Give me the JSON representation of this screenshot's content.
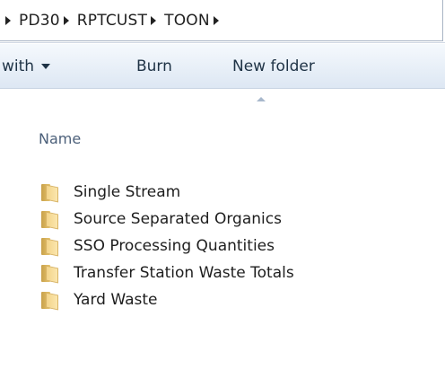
{
  "breadcrumb": {
    "items": [
      "PD30",
      "RPTCUST",
      "TOON"
    ]
  },
  "toolbar": {
    "share_label": "with",
    "burn_label": "Burn",
    "new_folder_label": "New folder"
  },
  "column": {
    "name_label": "Name"
  },
  "files": [
    {
      "name": "Single Stream",
      "type": "folder"
    },
    {
      "name": "Source Separated Organics",
      "type": "folder"
    },
    {
      "name": "SSO Processing Quantities",
      "type": "folder"
    },
    {
      "name": "Transfer Station Waste Totals",
      "type": "folder"
    },
    {
      "name": "Yard Waste",
      "type": "folder"
    }
  ],
  "icons": {
    "folder": "folder-icon",
    "breadcrumb_separator": "chevron-right-icon",
    "dropdown": "chevron-down-icon",
    "sort": "sort-ascending-icon"
  },
  "colors": {
    "toolbar_text": "#1e3245",
    "header_text": "#4c607a",
    "folder": "#f3d48a"
  }
}
